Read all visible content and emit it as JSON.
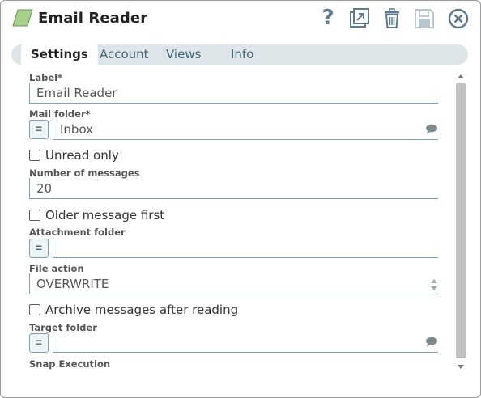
{
  "header": {
    "title": "Email Reader",
    "help_glyph": "?",
    "icons": [
      "snap-type-icon",
      "help-icon",
      "export-icon",
      "delete-icon",
      "save-icon",
      "close-icon"
    ]
  },
  "tabs": [
    {
      "label": "Settings",
      "active": true
    },
    {
      "label": "Account",
      "active": false
    },
    {
      "label": "Views",
      "active": false
    },
    {
      "label": "Info",
      "active": false
    }
  ],
  "form": {
    "label": {
      "label": "Label*",
      "value": "Email Reader"
    },
    "mail_folder": {
      "label": "Mail folder*",
      "value": "Inbox",
      "expr": "="
    },
    "unread_only": {
      "label": "Unread only",
      "checked": false
    },
    "num_messages": {
      "label": "Number of messages",
      "value": "20"
    },
    "older_first": {
      "label": "Older message first",
      "checked": false
    },
    "attachment_folder": {
      "label": "Attachment folder",
      "value": "",
      "expr": "="
    },
    "file_action": {
      "label": "File action",
      "value": "OVERWRITE"
    },
    "archive_after": {
      "label": "Archive messages after reading",
      "checked": false
    },
    "target_folder": {
      "label": "Target folder",
      "value": "",
      "expr": "="
    },
    "snap_execution": {
      "label": "Snap Execution"
    }
  },
  "colors": {
    "accent": "#7da0b2",
    "tab_text": "#3f6678",
    "tab_bar": "#dde5e8",
    "icon": "#5e7a8c",
    "snap_icon_fill": "#a8d08d"
  }
}
